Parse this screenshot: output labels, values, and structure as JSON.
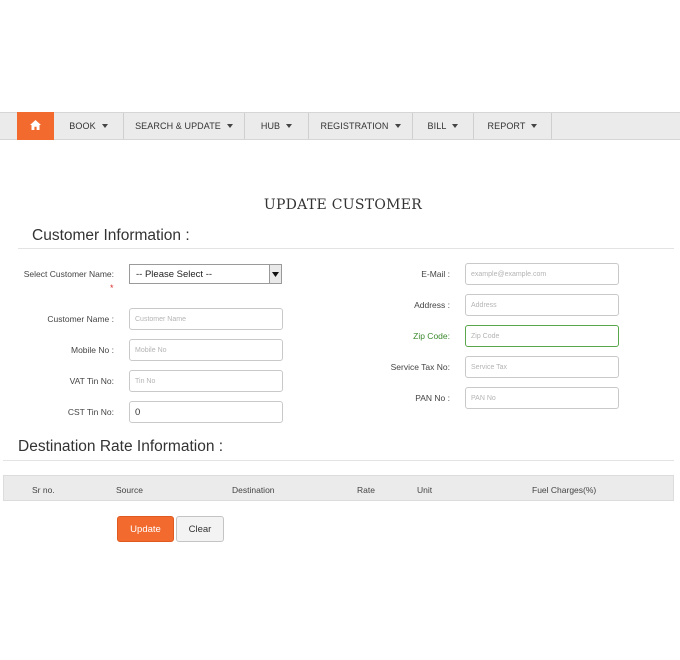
{
  "nav": {
    "home_icon": "home-icon",
    "items": [
      {
        "label": "BOOK"
      },
      {
        "label": "SEARCH & UPDATE"
      },
      {
        "label": "HUB"
      },
      {
        "label": "REGISTRATION"
      },
      {
        "label": "BILL"
      },
      {
        "label": "REPORT"
      }
    ]
  },
  "page_title": "UPDATE CUSTOMER",
  "customer_info": {
    "title": "Customer Information :",
    "select_customer": {
      "label": "Select Customer Name:",
      "required_mark": "*",
      "value": "-- Please Select --"
    },
    "customer_name": {
      "label": "Customer Name :",
      "placeholder": "Customer Name"
    },
    "mobile_no": {
      "label": "Mobile No :",
      "placeholder": "Mobile No"
    },
    "vat_tin_no": {
      "label": "VAT Tin No:",
      "placeholder": "Tin No"
    },
    "cst_tin_no": {
      "label": "CST Tin No:",
      "value": "0"
    },
    "email": {
      "label": "E-Mail :",
      "placeholder": "example@example.com"
    },
    "address": {
      "label": "Address :",
      "placeholder": "Address"
    },
    "zip_code": {
      "label": "Zip Code:",
      "placeholder": "Zip Code"
    },
    "service_tax_no": {
      "label": "Service Tax No:",
      "placeholder": "Service Tax"
    },
    "pan_no": {
      "label": "PAN No :",
      "placeholder": "PAN No"
    }
  },
  "destination_rate": {
    "title": "Destination Rate Information :",
    "columns": [
      "Sr no.",
      "Source",
      "Destination",
      "Rate",
      "Unit",
      "Fuel Charges(%)"
    ]
  },
  "buttons": {
    "update": "Update",
    "clear": "Clear"
  },
  "colors": {
    "accent": "#f26a2e",
    "zip_label": "#3c8a2e",
    "zip_border": "#5aa64a"
  }
}
